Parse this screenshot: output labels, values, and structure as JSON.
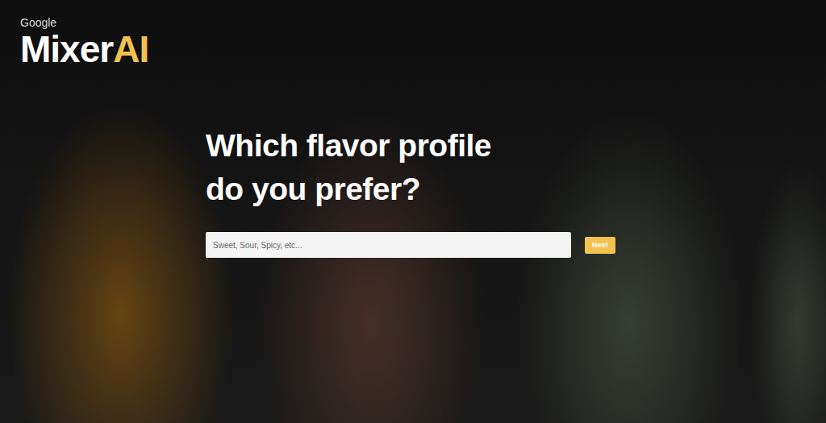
{
  "logo": {
    "brand": "Google",
    "name": "Mixer",
    "accent": "AI"
  },
  "heading": [
    "Which flavor profile",
    "do you prefer?"
  ],
  "search": {
    "placeholder": "Sweet, Sour, Spicy, etc..."
  },
  "buttons": [
    "Next"
  ]
}
